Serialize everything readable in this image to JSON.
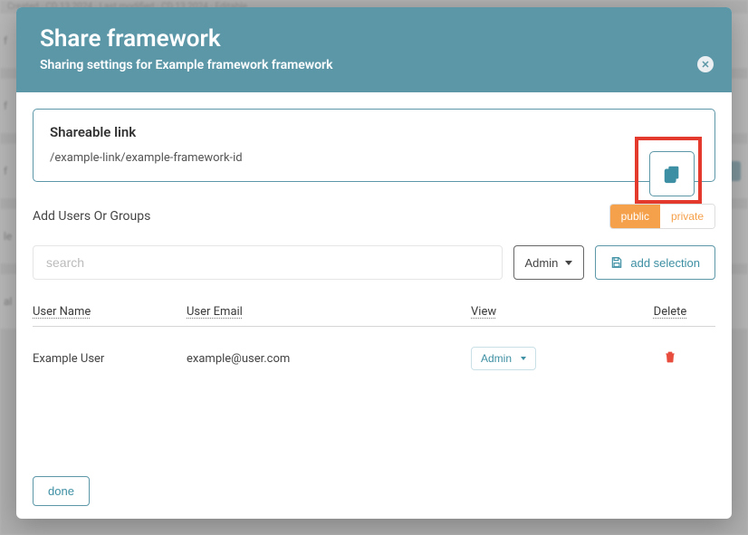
{
  "header": {
    "title": "Share framework",
    "subtitle": "Sharing settings for Example framework framework"
  },
  "shareable": {
    "section_title": "Shareable link",
    "url": "/example-link/example-framework-id"
  },
  "add_section": {
    "title": "Add Users Or Groups",
    "toggle_public": "public",
    "toggle_private": "private",
    "search_placeholder": "search",
    "role_label": "Admin",
    "add_button": "add selection"
  },
  "table": {
    "headers": {
      "name": "User Name",
      "email": "User Email",
      "view": "View",
      "delete": "Delete"
    },
    "rows": [
      {
        "name": "Example User",
        "email": "example@user.com",
        "role": "Admin"
      }
    ]
  },
  "footer": {
    "done": "done"
  }
}
